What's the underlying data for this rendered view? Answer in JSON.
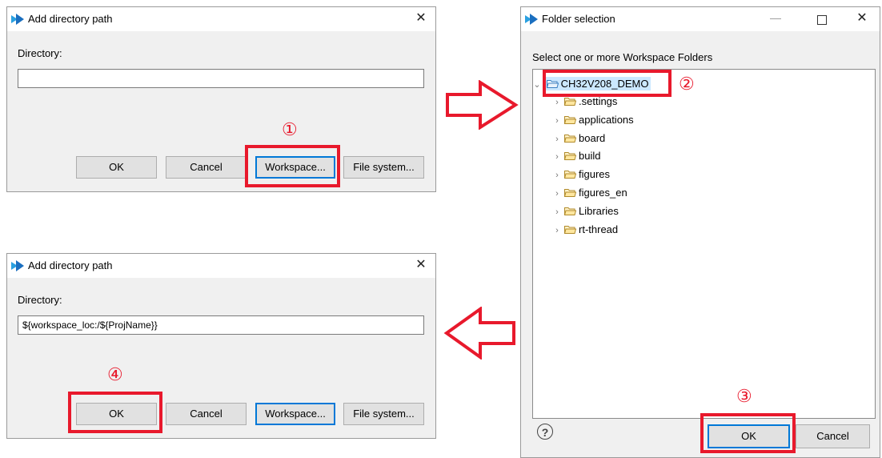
{
  "dialog_top": {
    "title": "Add directory path",
    "directory_label": "Directory:",
    "directory_value": "",
    "ok": "OK",
    "cancel": "Cancel",
    "workspace": "Workspace...",
    "file_system": "File system...",
    "step": "①"
  },
  "dialog_bottom": {
    "title": "Add directory path",
    "directory_label": "Directory:",
    "directory_value": "${workspace_loc:/${ProjName}}",
    "ok": "OK",
    "cancel": "Cancel",
    "workspace": "Workspace...",
    "file_system": "File system...",
    "step": "④"
  },
  "folder_dialog": {
    "title": "Folder selection",
    "prompt": "Select one or more Workspace Folders",
    "project": "CH32V208_DEMO",
    "project_step": "②",
    "folders": [
      ".settings",
      "applications",
      "board",
      "build",
      "figures",
      "figures_en",
      "Libraries",
      "rt-thread"
    ],
    "help": "?",
    "ok": "OK",
    "cancel": "Cancel",
    "ok_step": "③"
  },
  "colors": {
    "highlight": "#e8192c",
    "focus": "#0078d7",
    "dialog_bg": "#f0f0f0"
  }
}
